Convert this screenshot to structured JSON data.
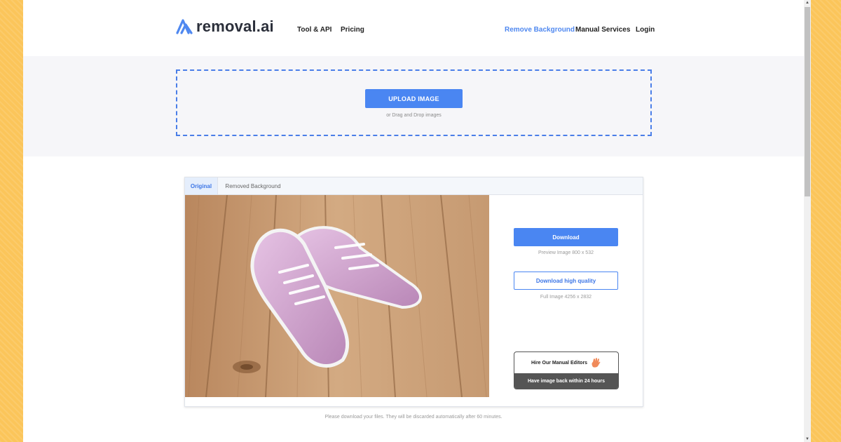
{
  "header": {
    "logo_text": "removal.ai",
    "nav_left": [
      "Tool & API",
      "Pricing"
    ],
    "nav_right": [
      "Remove Background",
      "Manual Services",
      "Login"
    ]
  },
  "upload": {
    "button_label": "UPLOAD IMAGE",
    "drag_text": "or Drag and Drop images"
  },
  "result": {
    "tabs": [
      "Original",
      "Removed Background"
    ],
    "download_label": "Download",
    "preview_info": "Preview Image   800 x 532",
    "download_hq_label": "Download high quality",
    "full_info": "Full Image   4256 x 2832",
    "hire_title": "Hire Our Manual Editors",
    "hire_subtitle": "Have image back within 24 hours"
  },
  "footer_note": "Please download your files. They will be discarded automatically after 60 minutes.",
  "colors": {
    "accent": "#4a86f2",
    "page_bg": "#fbc55a",
    "band_bg": "#f6f6f9"
  },
  "icons": [
    "logo-icon",
    "waving-hand-icon",
    "scroll-up-icon",
    "scroll-down-icon"
  ]
}
